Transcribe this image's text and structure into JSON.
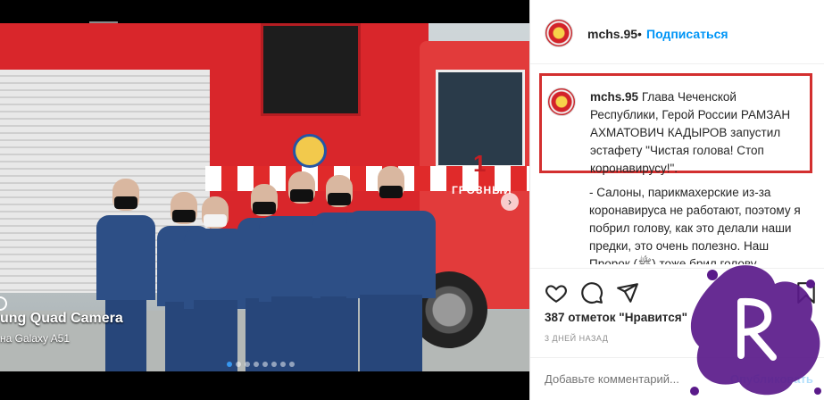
{
  "photo": {
    "camera_line1": "ung Quad Camera",
    "camera_line2": "на Galaxy A51",
    "truck_number": "1",
    "truck_city": "ГРОЗНЫЙ",
    "carousel_dots": 8,
    "active_dot": 0
  },
  "header": {
    "username": "mchs.95",
    "separator": "•",
    "follow_label": "Подписаться"
  },
  "caption": {
    "username": "mchs.95",
    "text": "Глава Чеченской Республики, Герой России РАМЗАН АХМАТОВИЧ КАДЫРОВ запустил эстафету \"Чистая голова! Стоп коронавирусу!\"."
  },
  "comment_continued": "- Салоны, парикмахерские из-за коронавируса не работают, поэтому я побрил голову, как это делали наши предки, это очень полезно. Наш Пророк (ﷺ) тоже брил голову.",
  "likes": "387 отметок \"Нравится\"",
  "date": "3 ДНЕЙ НАЗАД",
  "comment": {
    "placeholder": "Добавьте комментарий...",
    "publish_label": "Опубликовать"
  },
  "colors": {
    "accent": "#0095f6",
    "highlight_border": "#d32f2f",
    "watermark": "#5a1a8a"
  },
  "icons": [
    "heart-icon",
    "comment-icon",
    "share-icon",
    "bookmark-icon",
    "next-arrow-icon"
  ]
}
